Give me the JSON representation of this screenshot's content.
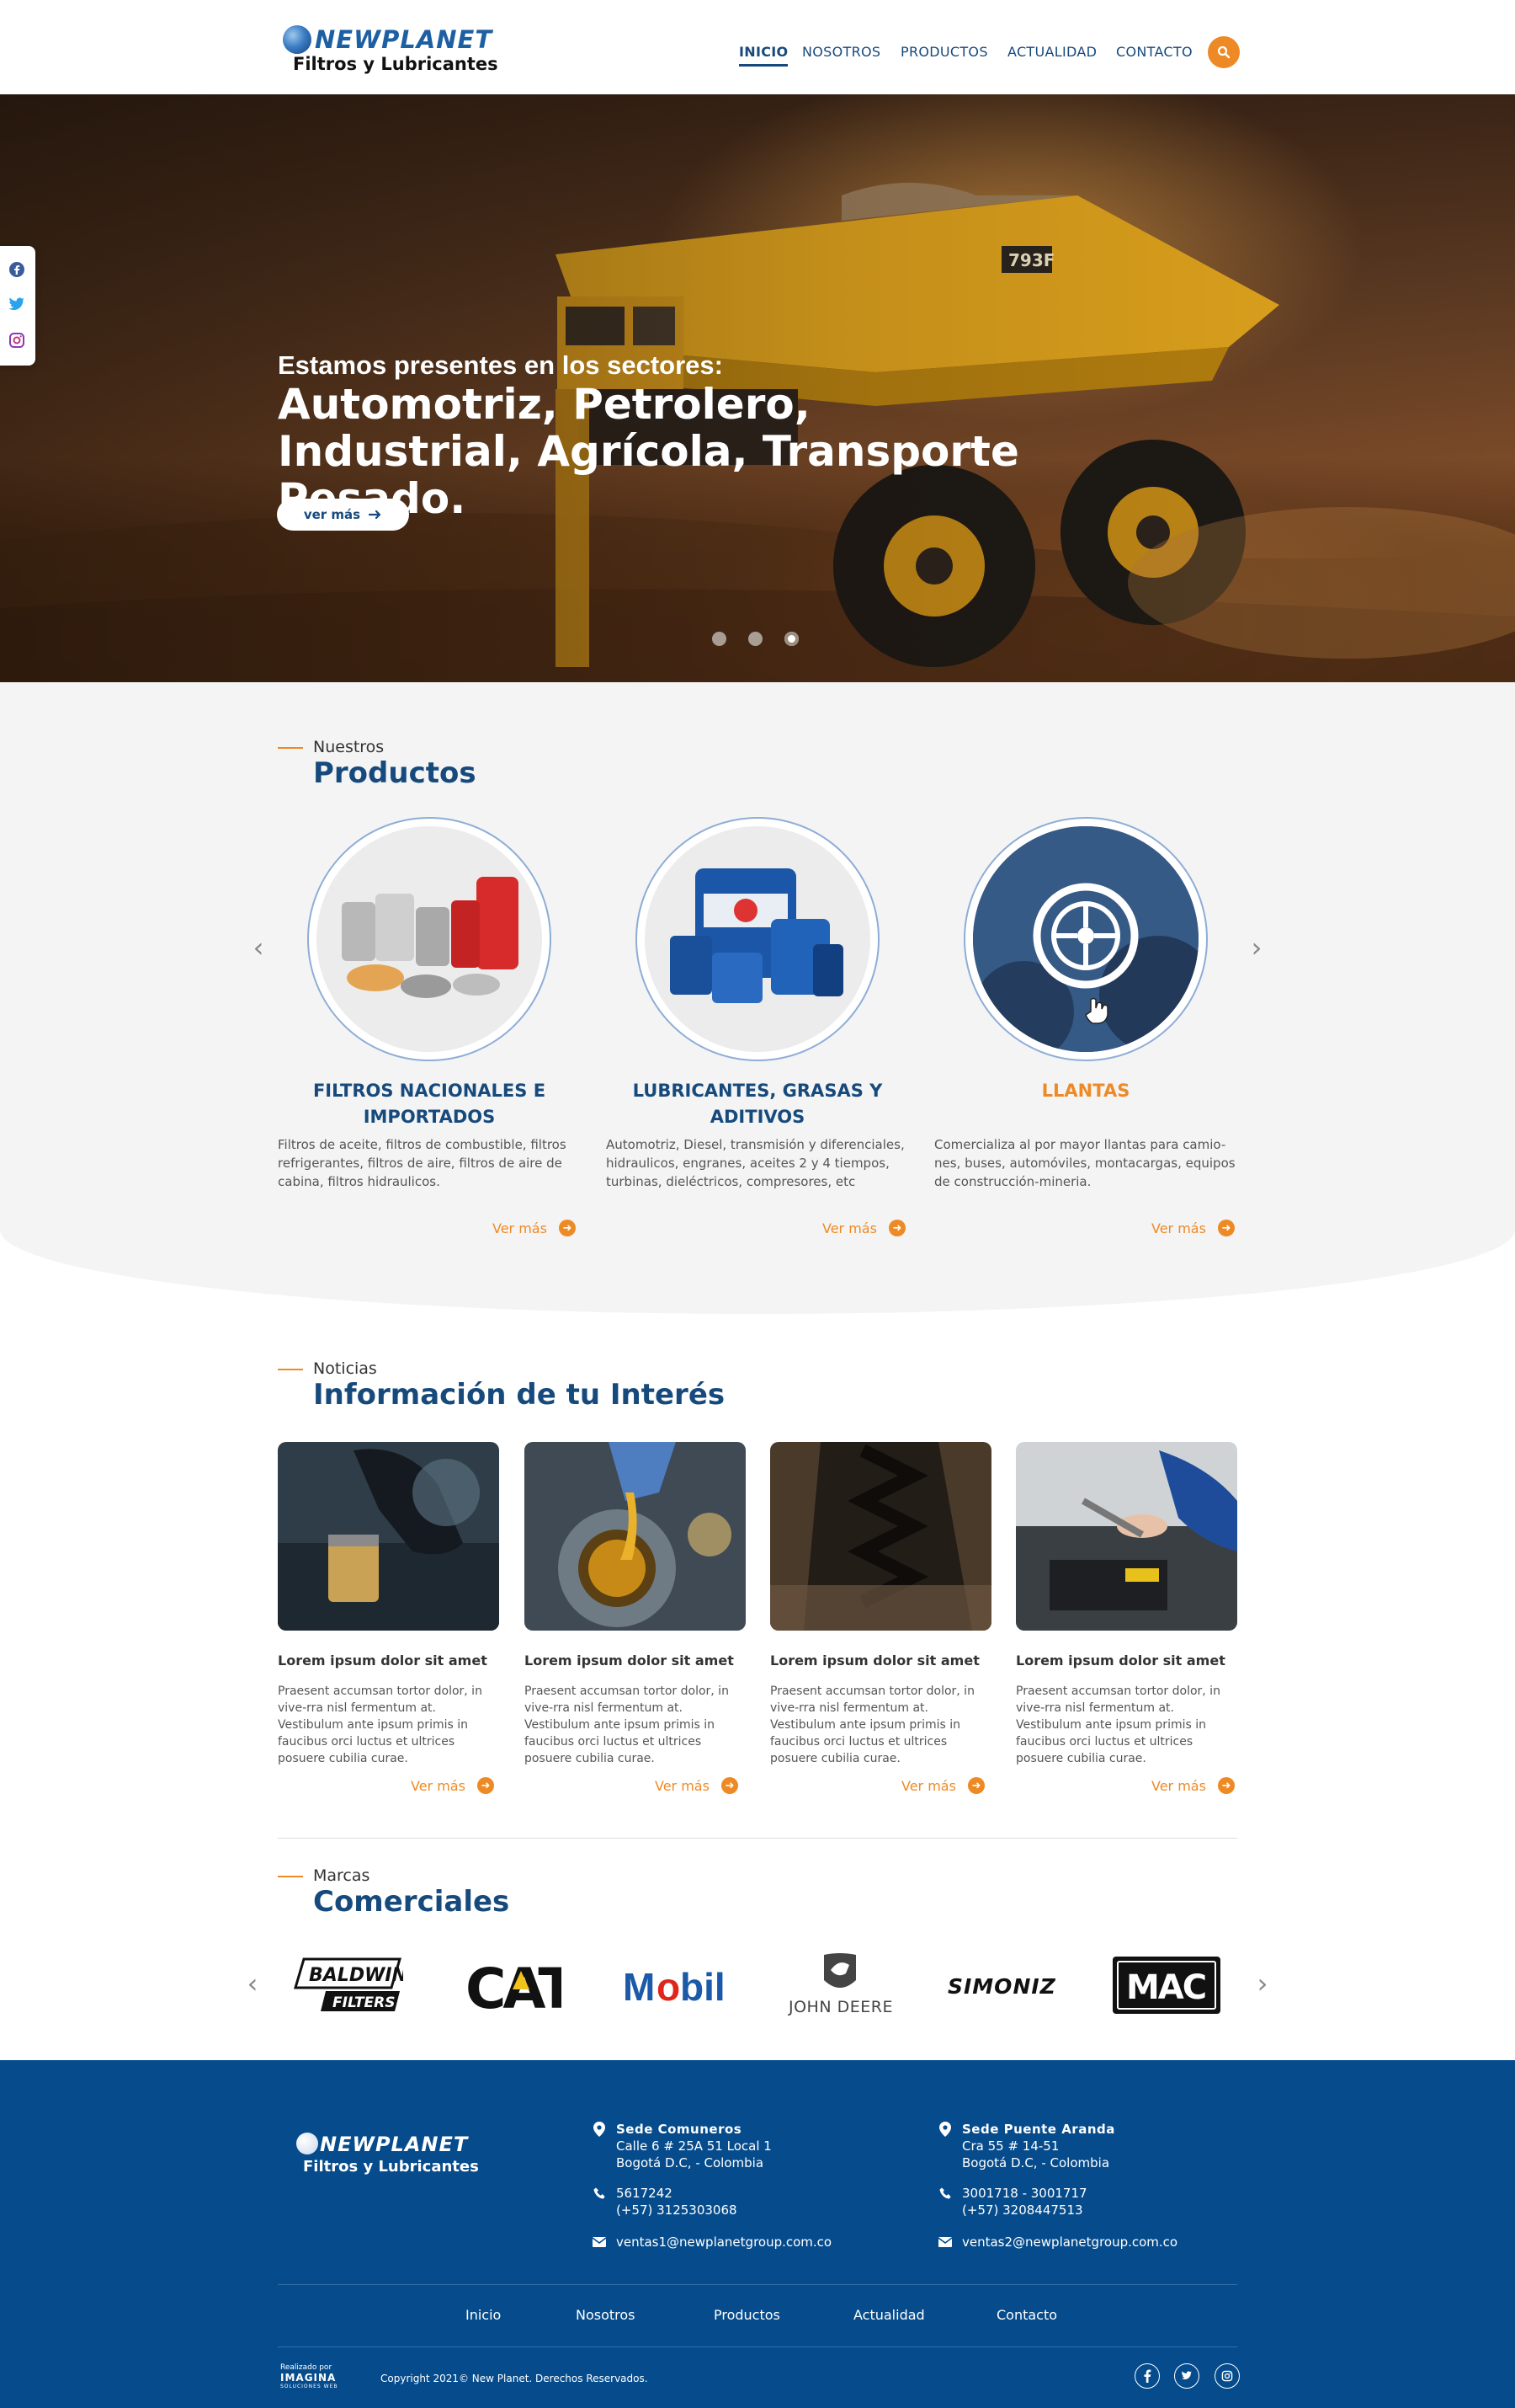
{
  "header": {
    "brand": "NEWPLANET",
    "tagline": "Filtros y Lubricantes",
    "nav": [
      "INICIO",
      "NOSOTROS",
      "PRODUCTOS",
      "ACTUALIDAD",
      "CONTACTO"
    ],
    "active_nav": "INICIO"
  },
  "hero": {
    "subtitle": "Estamos presentes en los sectores:",
    "title": "Automotriz, Petrolero, Industrial, Agrícola, Transporte Pesado.",
    "button": "ver más",
    "slides": 3,
    "active_slide": 3
  },
  "products": {
    "kicker": "Nuestros",
    "title": "Productos",
    "items": [
      {
        "title": "FILTROS NACIONALES E IMPORTADOS",
        "text": "Filtros de aceite, filtros de combustible, filtros refrigerantes, filtros de aire, filtros de aire de cabina, filtros hidraulicos.",
        "link": "Ver más"
      },
      {
        "title": "LUBRICANTES, GRASAS Y ADITIVOS",
        "text": "Automotriz, Diesel, transmisión y diferenciales, hidraulicos, engranes, aceites 2 y 4 tiempos, turbinas, dieléctricos, compresores, etc",
        "link": "Ver más"
      },
      {
        "title": "LLANTAS",
        "text": "Comercializa al por mayor llantas para camio-nes, buses, automóviles, montacargas, equipos de construcción-mineria.",
        "link": "Ver más"
      }
    ]
  },
  "news": {
    "kicker": "Noticias",
    "title": "Información de tu Interés",
    "items": [
      {
        "title": "Lorem ipsum dolor sit amet",
        "text": "Praesent accumsan tortor dolor, in vive-rra nisl fermentum at. Vestibulum ante ipsum primis in faucibus orci luctus et ultrices posuere cubilia curae.",
        "link": "Ver más"
      },
      {
        "title": "Lorem ipsum dolor sit amet",
        "text": "Praesent accumsan tortor dolor, in vive-rra nisl fermentum at. Vestibulum ante ipsum primis in faucibus orci luctus et ultrices posuere cubilia curae.",
        "link": "Ver más"
      },
      {
        "title": "Lorem ipsum dolor sit amet",
        "text": "Praesent accumsan tortor dolor, in vive-rra nisl fermentum at. Vestibulum ante ipsum primis in faucibus orci luctus et ultrices posuere cubilia curae.",
        "link": "Ver más"
      },
      {
        "title": "Lorem ipsum dolor sit amet",
        "text": "Praesent accumsan tortor dolor, in vive-rra nisl fermentum at. Vestibulum ante ipsum primis in faucibus orci luctus et ultrices posuere cubilia curae.",
        "link": "Ver más"
      }
    ]
  },
  "brands": {
    "kicker": "Marcas",
    "title": "Comerciales",
    "items": [
      "BALDWIN FILTERS",
      "CAT",
      "Mobil",
      "JOHN DEERE",
      "SIMONIZ",
      "MAC"
    ]
  },
  "footer": {
    "brand": "NEWPLANET",
    "tagline": "Filtros y Lubricantes",
    "sede1": {
      "name": "Sede Comuneros",
      "address1": "Calle 6 # 25A 51 Local 1",
      "address2": "Bogotá D.C, - Colombia",
      "phone1": "5617242",
      "phone2": "(+57) 3125303068",
      "email": "ventas1@newplanetgroup.com.co"
    },
    "sede2": {
      "name": "Sede Puente Aranda",
      "address1": "Cra 55 # 14-51",
      "address2": "Bogotá D.C, - Colombia",
      "phone1": "3001718 - 3001717",
      "phone2": "(+57) 3208447513",
      "email": "ventas2@newplanetgroup.com.co"
    },
    "nav": [
      "Inicio",
      "Nosotros",
      "Productos",
      "Actualidad",
      "Contacto"
    ],
    "realizado": "Realizado por",
    "imagina": "IMAGINA",
    "imagina_sub": "SOLUCIONES WEB",
    "copyright": "Copyright 2021© New Planet. Derechos Reservados."
  },
  "colors": {
    "primary": "#174a7c",
    "accent": "#ee8a25",
    "footer": "#064c8c",
    "section_bg": "#f4f4f4"
  },
  "icons": [
    "search-icon",
    "facebook-icon",
    "twitter-icon",
    "instagram-icon",
    "arrow-right-icon",
    "chevron-left-icon",
    "chevron-right-icon",
    "map-pin-icon",
    "phone-icon",
    "mail-icon"
  ]
}
